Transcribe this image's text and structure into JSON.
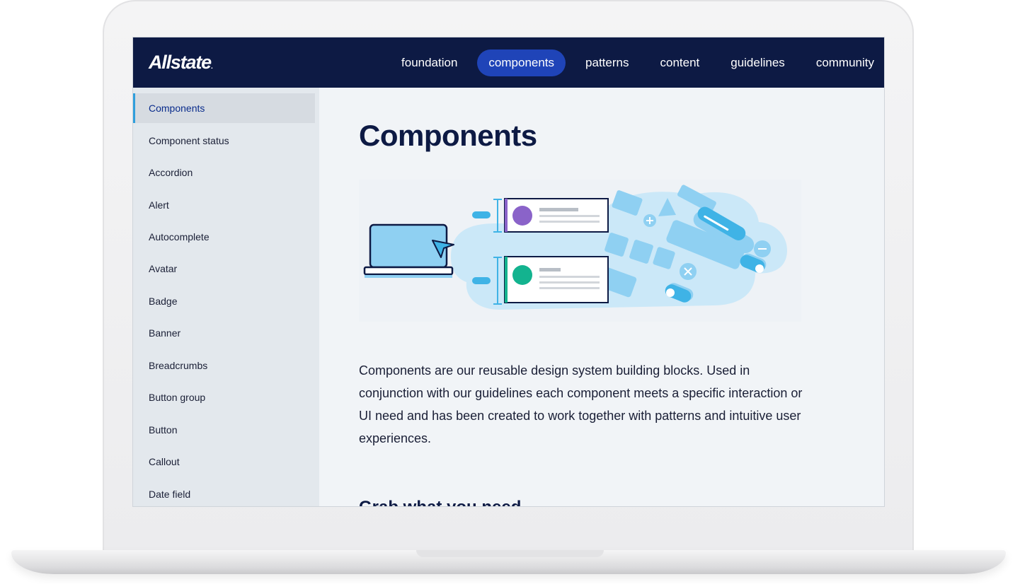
{
  "brand": {
    "logo_text": "Allstate",
    "logo_mark": "."
  },
  "nav": {
    "items": [
      {
        "label": "foundation",
        "active": false
      },
      {
        "label": "components",
        "active": true
      },
      {
        "label": "patterns",
        "active": false
      },
      {
        "label": "content",
        "active": false
      },
      {
        "label": "guidelines",
        "active": false
      },
      {
        "label": "community",
        "active": false
      }
    ]
  },
  "sidebar": {
    "items": [
      {
        "label": "Components",
        "active": true
      },
      {
        "label": "Component status"
      },
      {
        "label": "Accordion"
      },
      {
        "label": "Alert"
      },
      {
        "label": "Autocomplete"
      },
      {
        "label": "Avatar"
      },
      {
        "label": "Badge"
      },
      {
        "label": "Banner"
      },
      {
        "label": "Breadcrumbs"
      },
      {
        "label": "Button group"
      },
      {
        "label": "Button"
      },
      {
        "label": "Callout"
      },
      {
        "label": "Date field"
      }
    ]
  },
  "main": {
    "title": "Components",
    "intro": "Components are our reusable design system building blocks. Used in conjunction with our guidelines each component meets a specific interaction or UI need and has been created to work together with patterns and intuitive user experiences.",
    "subheading": "Grab what you need"
  },
  "colors": {
    "header_bg": "#0d1a44",
    "active_nav": "#1f44b8",
    "sidebar_accent": "#2f9fdc",
    "illustration_blue": "#8fd0f2",
    "avatar_purple": "#8a63c9",
    "avatar_green": "#13b38f"
  }
}
